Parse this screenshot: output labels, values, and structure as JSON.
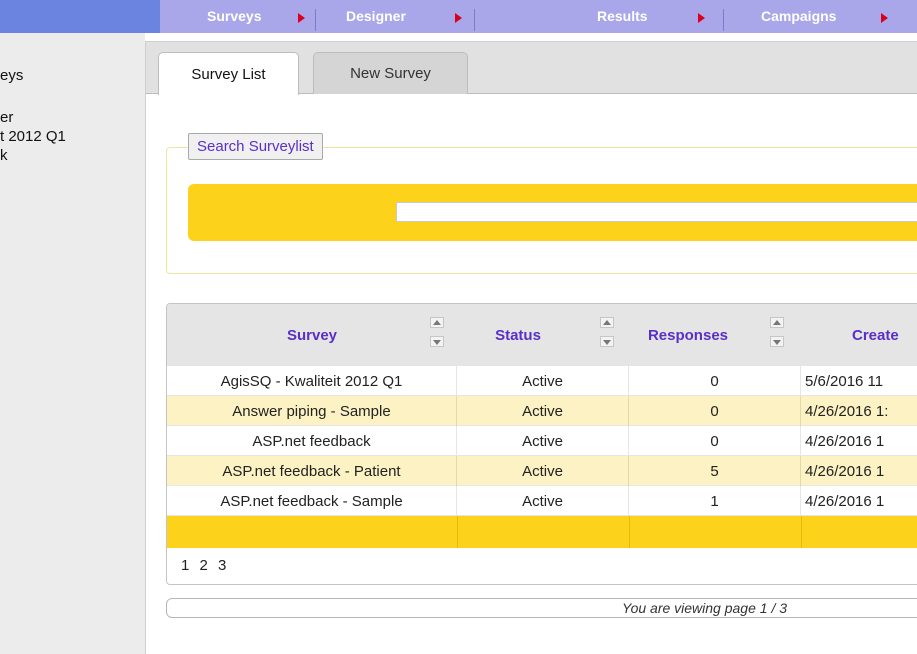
{
  "nav": {
    "items": [
      {
        "label": "Surveys"
      },
      {
        "label": "Designer"
      },
      {
        "label": "Results"
      },
      {
        "label": "Campaigns"
      }
    ]
  },
  "sidebar": {
    "items": [
      {
        "label": "eys"
      },
      {
        "label": "er"
      },
      {
        "label": "t 2012 Q1"
      },
      {
        "label": "k"
      }
    ]
  },
  "tabs": [
    {
      "label": "Survey List",
      "active": true
    },
    {
      "label": "New Survey",
      "active": false
    }
  ],
  "search": {
    "legend": "Search Surveylist",
    "value": "",
    "placeholder": ""
  },
  "grid": {
    "columns": [
      "Survey",
      "Status",
      "Responses",
      "Create"
    ],
    "rows": [
      {
        "survey": "AgisSQ - Kwaliteit 2012 Q1",
        "status": "Active",
        "responses": "0",
        "created": "5/6/2016 11"
      },
      {
        "survey": "Answer piping - Sample",
        "status": "Active",
        "responses": "0",
        "created": "4/26/2016 1:"
      },
      {
        "survey": "ASP.net feedback",
        "status": "Active",
        "responses": "0",
        "created": "4/26/2016 1"
      },
      {
        "survey": "ASP.net feedback - Patient",
        "status": "Active",
        "responses": "5",
        "created": "4/26/2016 1"
      },
      {
        "survey": "ASP.net feedback - Sample",
        "status": "Active",
        "responses": "1",
        "created": "4/26/2016 1"
      }
    ],
    "pages": [
      "1",
      "2",
      "3"
    ]
  },
  "status_text": "You are viewing page 1 / 3",
  "colors": {
    "nav_bg": "#a9a7ea",
    "accent_yellow": "#fcd21a",
    "link_purple": "#5a2fc8",
    "arrow_red": "#d9001c"
  }
}
